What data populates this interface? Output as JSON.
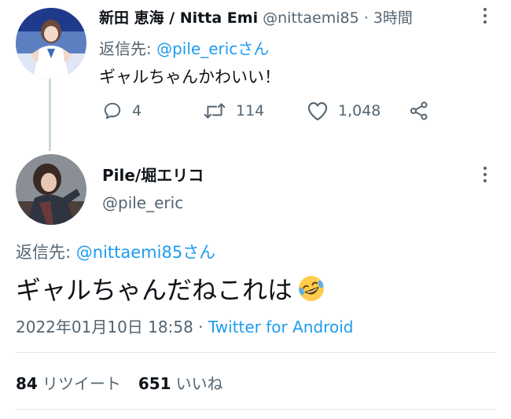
{
  "tweet_reply": {
    "display_name": "新田 恵海 / Nitta Emi",
    "handle": "@nittaemi85",
    "separator": "·",
    "time": "3時間",
    "reply_to_prefix": "返信先: ",
    "reply_to_mention": "@pile_eric",
    "reply_to_suffix": "さん",
    "text": "ギャルちゃんかわいい！",
    "actions": {
      "replies": "4",
      "retweets": "114",
      "likes": "1,048"
    }
  },
  "tweet_main": {
    "display_name": "Pile/堀エリコ",
    "handle": "@pile_eric",
    "reply_to_prefix": "返信先: ",
    "reply_to_mention": "@nittaemi85",
    "reply_to_suffix": "さん",
    "text": "ギャルちゃんだねこれは",
    "timestamp": "2022年01月10日 18:58",
    "separator": " · ",
    "source": "Twitter for Android",
    "stats": {
      "retweets_count": "84",
      "retweets_label": "リツイート",
      "likes_count": "651",
      "likes_label": "いいね"
    }
  },
  "icons": [
    "more-dots-icon",
    "reply-icon",
    "retweet-icon",
    "like-icon",
    "share-icon",
    "rofl-emoji"
  ],
  "colors": {
    "link": "#1d9bf0",
    "secondary": "#536471",
    "primary": "#0f1419",
    "divider": "#e1e6ea"
  }
}
